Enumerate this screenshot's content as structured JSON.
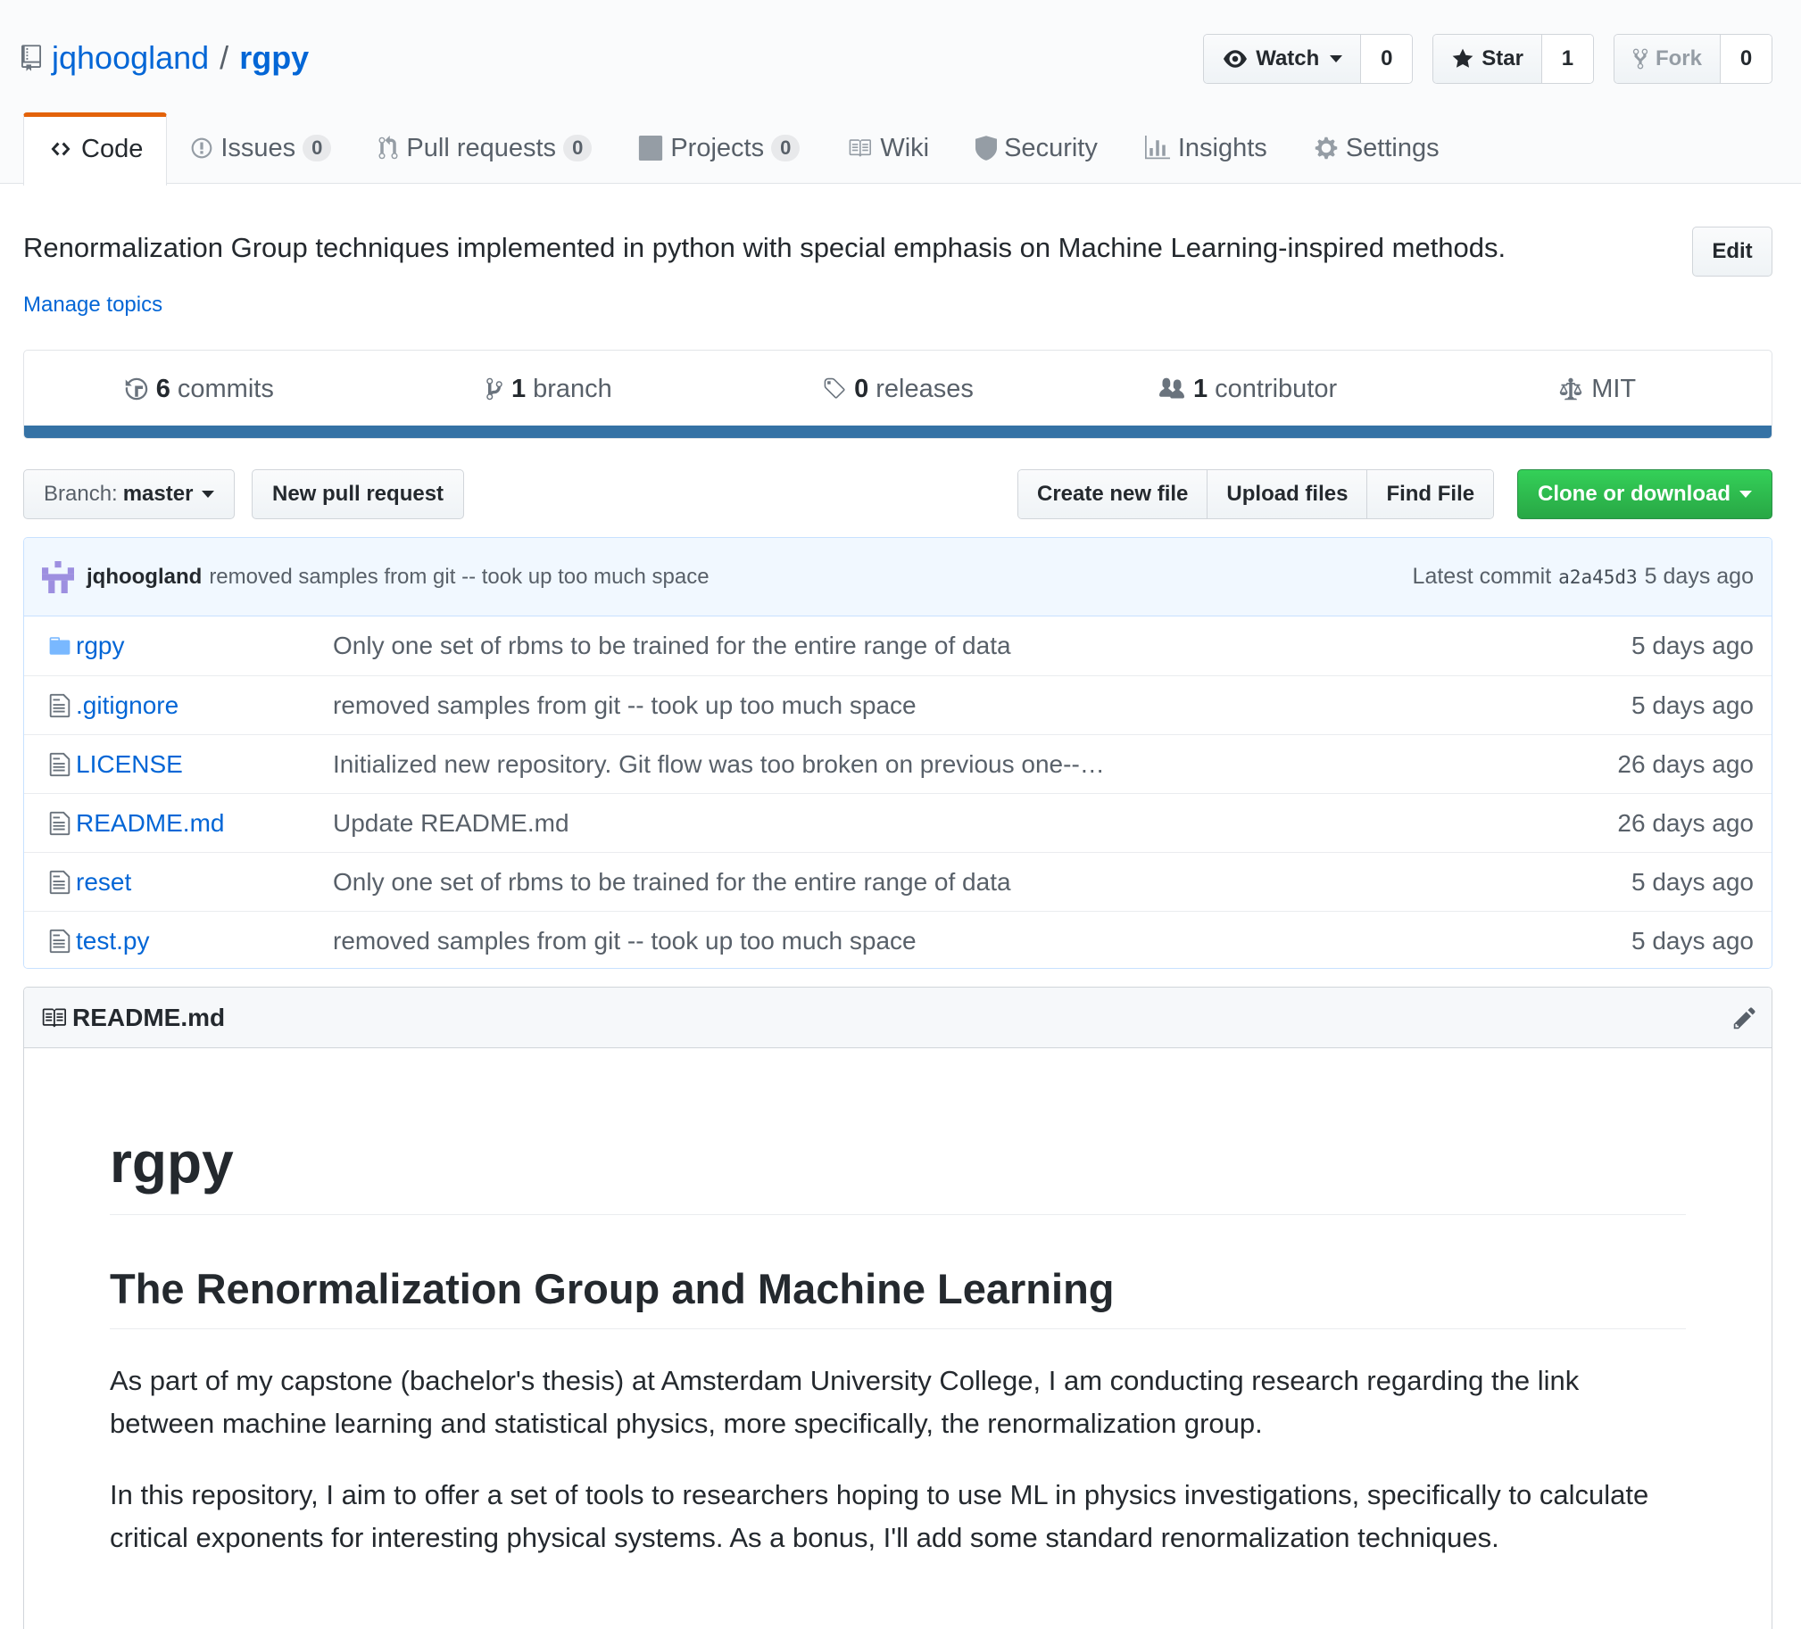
{
  "repo": {
    "owner": "jqhoogland",
    "separator": "/",
    "name": "rgpy"
  },
  "actions": {
    "watch_label": "Watch",
    "watch_count": "0",
    "star_label": "Star",
    "star_count": "1",
    "fork_label": "Fork",
    "fork_count": "0"
  },
  "tabs": [
    {
      "label": "Code",
      "counter": null
    },
    {
      "label": "Issues",
      "counter": "0"
    },
    {
      "label": "Pull requests",
      "counter": "0"
    },
    {
      "label": "Projects",
      "counter": "0"
    },
    {
      "label": "Wiki",
      "counter": null
    },
    {
      "label": "Security",
      "counter": null
    },
    {
      "label": "Insights",
      "counter": null
    },
    {
      "label": "Settings",
      "counter": null
    }
  ],
  "description": "Renormalization Group techniques implemented in python with special emphasis on Machine Learning-inspired methods.",
  "edit_label": "Edit",
  "manage_topics": "Manage topics",
  "summary": {
    "commits_num": "6",
    "commits_label": "commits",
    "branch_num": "1",
    "branch_label": "branch",
    "releases_num": "0",
    "releases_label": "releases",
    "contributor_num": "1",
    "contributor_label": "contributor",
    "license": "MIT",
    "language_color": "#3572a5"
  },
  "filenav": {
    "branch_label": "Branch:",
    "branch_value": "master",
    "new_pr": "New pull request",
    "create_file": "Create new file",
    "upload_files": "Upload files",
    "find_file": "Find File",
    "clone": "Clone or download"
  },
  "commit": {
    "author": "jqhoogland",
    "message": "removed samples from git -- took up too much space",
    "latest_label": "Latest commit",
    "sha": "a2a45d3",
    "age": "5 days ago"
  },
  "files": [
    {
      "type": "dir",
      "name": "rgpy",
      "message": "Only one set of rbms to be trained for the entire range of data",
      "age": "5 days ago"
    },
    {
      "type": "file",
      "name": ".gitignore",
      "message": "removed samples from git -- took up too much space",
      "age": "5 days ago"
    },
    {
      "type": "file",
      "name": "LICENSE",
      "message": "Initialized new repository. Git flow was too broken on previous one--…",
      "age": "26 days ago"
    },
    {
      "type": "file",
      "name": "README.md",
      "message": "Update README.md",
      "age": "26 days ago"
    },
    {
      "type": "file",
      "name": "reset",
      "message": "Only one set of rbms to be trained for the entire range of data",
      "age": "5 days ago"
    },
    {
      "type": "file",
      "name": "test.py",
      "message": "removed samples from git -- took up too much space",
      "age": "5 days ago"
    }
  ],
  "readme": {
    "filename": "README.md",
    "h1": "rgpy",
    "h2": "The Renormalization Group and Machine Learning",
    "p1": "As part of my capstone (bachelor's thesis) at Amsterdam University College, I am conducting research regarding the link between machine learning and statistical physics, more specifically, the renormalization group.",
    "p2": "In this repository, I aim to offer a set of tools to researchers hoping to use ML in physics investigations, specifically to calculate critical exponents for interesting physical systems. As a bonus, I'll add some standard renormalization techniques."
  }
}
